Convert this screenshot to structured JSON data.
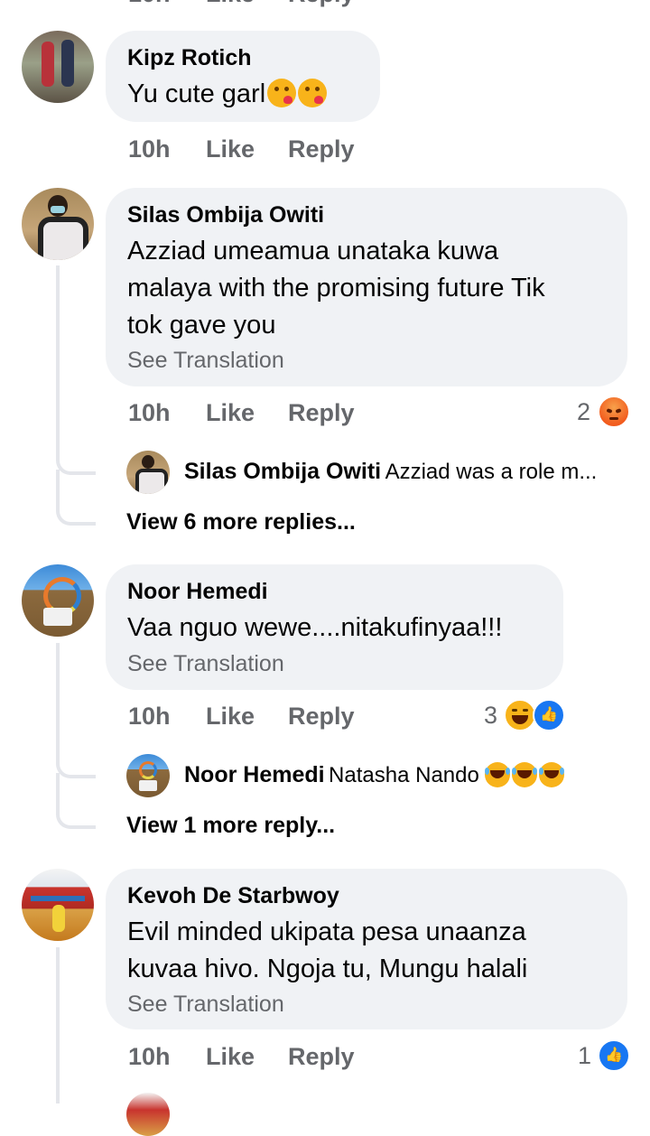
{
  "comments": [
    {
      "author": "Kipz Rotich",
      "text": "Yu cute garl",
      "time": "10h",
      "like": "Like",
      "reply": "Reply"
    },
    {
      "author": "Silas Ombija Owiti",
      "text_lines": [
        "Azziad umeamua unataka kuwa",
        "malaya with the promising future Tik",
        "tok gave you"
      ],
      "see_translation": "See Translation",
      "time": "10h",
      "like": "Like",
      "reply": "Reply",
      "reaction_count": "2",
      "reply_preview": {
        "author": "Silas Ombija Owiti",
        "text": "Azziad was a role m..."
      },
      "view_more": "View 6 more replies..."
    },
    {
      "author": "Noor Hemedi",
      "text": "Vaa nguo wewe....nitakufinyaa!!!",
      "see_translation": "See Translation",
      "time": "10h",
      "like": "Like",
      "reply": "Reply",
      "reaction_count": "3",
      "reply_preview": {
        "author": "Noor Hemedi",
        "text": "Natasha Nando"
      },
      "view_more": "View 1 more reply..."
    },
    {
      "author": "Kevoh De Starbwoy",
      "text_lines": [
        "Evil minded ukipata pesa unaanza",
        "kuvaa hivo. Ngoja tu, Mungu halali"
      ],
      "see_translation": "See Translation",
      "time": "10h",
      "like": "Like",
      "reply": "Reply",
      "reaction_count": "1"
    }
  ],
  "top_partial": {
    "time": "10h",
    "like": "Like",
    "reply": "Reply"
  },
  "colors": {
    "bubble": "#f0f2f5",
    "meta": "#65676b",
    "like_blue": "#1877f2",
    "angry": "#f25c1e",
    "haha": "#f8b31a"
  },
  "icons": [
    "kiss-emoji-icon",
    "angry-reaction-icon",
    "haha-reaction-icon",
    "like-reaction-icon",
    "laughing-emoji-icon"
  ]
}
